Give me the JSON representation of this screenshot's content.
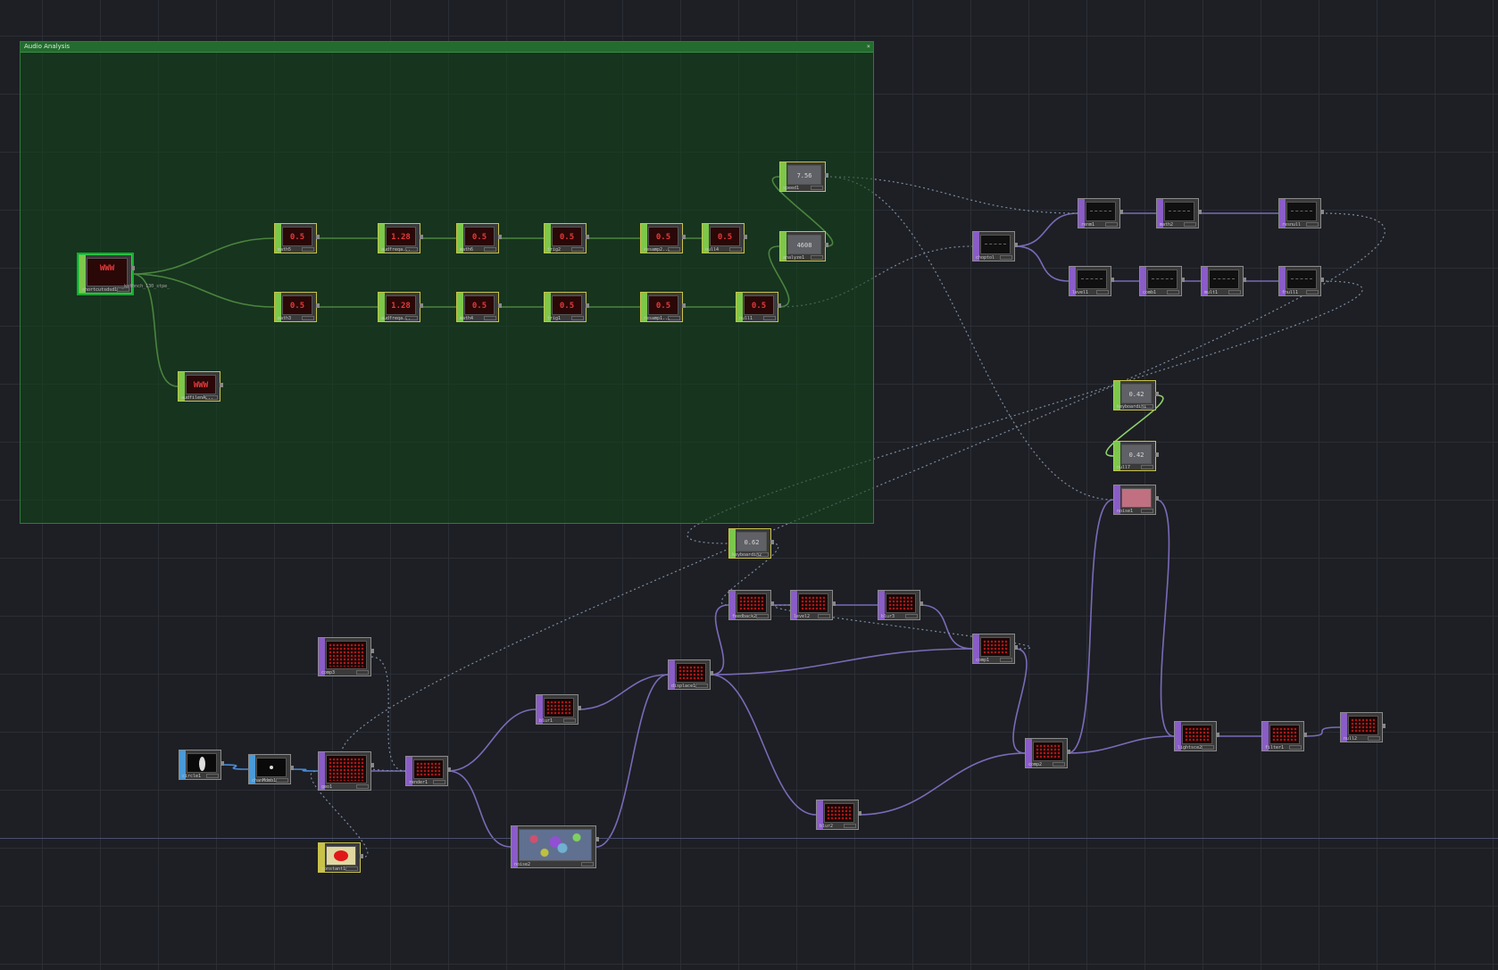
{
  "annotation": {
    "title": "Audio Analysis",
    "close_glyph": "×"
  },
  "colors": {
    "top": "#8a5cc8",
    "chop": "#7cc84a",
    "sop": "#4a9ad8",
    "dat": "#c8c24a",
    "wire_chop": "#8fd06a",
    "wire_top": "#7a6ab8",
    "wire_sop": "#4a8ad8",
    "wire_ref": "#7c8aa0"
  },
  "nodes": [
    {
      "id": "audio",
      "label": "shortcutsdsd1_...",
      "family": "chop",
      "preview": "redtxt",
      "text": "WWW",
      "sel": true
    },
    {
      "id": "math5",
      "label": "math5",
      "family": "chop",
      "preview": "redtxt",
      "text": "0.5"
    },
    {
      "id": "afe3",
      "label": "audfreqa...",
      "family": "chop",
      "preview": "redtxt",
      "text": "1.28"
    },
    {
      "id": "math6",
      "label": "math6",
      "family": "chop",
      "preview": "redtxt",
      "text": "0.5"
    },
    {
      "id": "trig2",
      "label": "trig2",
      "family": "chop",
      "preview": "redtxt",
      "text": "0.5"
    },
    {
      "id": "resamp2",
      "label": "resamp2...",
      "family": "chop",
      "preview": "redtxt",
      "text": "0.5"
    },
    {
      "id": "null4",
      "label": "null4",
      "family": "chop",
      "preview": "redtxt",
      "text": "0.5"
    },
    {
      "id": "math3",
      "label": "math3",
      "family": "chop",
      "preview": "redtxt",
      "text": "0.5"
    },
    {
      "id": "afe1",
      "label": "audfreqa...",
      "family": "chop",
      "preview": "redtxt",
      "text": "1.28"
    },
    {
      "id": "math4",
      "label": "math4",
      "family": "chop",
      "preview": "redtxt",
      "text": "0.5"
    },
    {
      "id": "trig1",
      "label": "trig1",
      "family": "chop",
      "preview": "redtxt",
      "text": "0.5"
    },
    {
      "id": "resamp1",
      "label": "resamp1...",
      "family": "chop",
      "preview": "redtxt",
      "text": "0.5"
    },
    {
      "id": "null1",
      "label": "null1",
      "family": "chop",
      "preview": "redtxt",
      "text": "0.5"
    },
    {
      "id": "audfilt",
      "label": "audfilenA...",
      "family": "chop",
      "preview": "redtxt",
      "text": "WWW"
    },
    {
      "id": "speed1",
      "label": "speed1",
      "family": "chop",
      "preview": "gray",
      "text": "7.56 chan"
    },
    {
      "id": "analyze",
      "label": "analyze1",
      "family": "chop",
      "preview": "gray",
      "text": "4608 chan"
    },
    {
      "id": "chop1",
      "label": "choptol",
      "family": "top",
      "preview": "dark"
    },
    {
      "id": "ren1",
      "label": "renm1",
      "family": "top",
      "preview": "dark"
    },
    {
      "id": "math2",
      "label": "math2",
      "family": "top",
      "preview": "dark"
    },
    {
      "id": "resnull",
      "label": "resnull",
      "family": "top",
      "preview": "dark"
    },
    {
      "id": "level1",
      "label": "level1",
      "family": "top",
      "preview": "dark"
    },
    {
      "id": "comb1",
      "label": "comb1",
      "family": "top",
      "preview": "dark"
    },
    {
      "id": "mult1",
      "label": "mult1",
      "family": "top",
      "preview": "dark"
    },
    {
      "id": "fnull1",
      "label": "fnull1",
      "family": "top",
      "preview": "dark"
    },
    {
      "id": "kbd1",
      "label": "keyboardin1",
      "family": "chop",
      "preview": "gray",
      "text": "0.42"
    },
    {
      "id": "null7",
      "label": "null7",
      "family": "chop",
      "preview": "gray",
      "text": "0.42"
    },
    {
      "id": "noise1",
      "label": "noise1",
      "family": "top",
      "preview": "pink"
    },
    {
      "id": "kbd2",
      "label": "keyboardin2",
      "family": "chop",
      "preview": "gray",
      "text": "0.62"
    },
    {
      "id": "fb2",
      "label": "feedback2",
      "family": "top",
      "preview": "red"
    },
    {
      "id": "level2",
      "label": "level2",
      "family": "top",
      "preview": "red"
    },
    {
      "id": "blur3",
      "label": "blur3",
      "family": "top",
      "preview": "red"
    },
    {
      "id": "comp1",
      "label": "comp1",
      "family": "top",
      "preview": "red"
    },
    {
      "id": "disp1",
      "label": "displace1",
      "family": "top",
      "preview": "red"
    },
    {
      "id": "comp3",
      "label": "comp3",
      "family": "top",
      "preview": "red"
    },
    {
      "id": "blur1",
      "label": "blur1",
      "family": "top",
      "preview": "red"
    },
    {
      "id": "circle1",
      "label": "circle1",
      "family": "sop",
      "preview": "oval"
    },
    {
      "id": "cam1",
      "label": "chanMdmb1",
      "family": "sop",
      "preview": "circle"
    },
    {
      "id": "geo1",
      "label": "geo1",
      "family": "top",
      "preview": "red"
    },
    {
      "id": "render1",
      "label": "render1",
      "family": "top",
      "preview": "red"
    },
    {
      "id": "const1",
      "label": "constant1",
      "family": "dat",
      "preview": "redblob"
    },
    {
      "id": "noise2",
      "label": "noise2",
      "family": "top",
      "preview": "noisy"
    },
    {
      "id": "blur2",
      "label": "blur2",
      "family": "top",
      "preview": "red"
    },
    {
      "id": "comp2",
      "label": "comp2",
      "family": "top",
      "preview": "red"
    },
    {
      "id": "lsp2",
      "label": "lightsce2",
      "family": "top",
      "preview": "red"
    },
    {
      "id": "flt1",
      "label": "filter1",
      "family": "top",
      "preview": "red"
    },
    {
      "id": "null2",
      "label": "null2",
      "family": "top",
      "preview": "red"
    }
  ],
  "extra_label": "_kathnch_130_stpe_"
}
